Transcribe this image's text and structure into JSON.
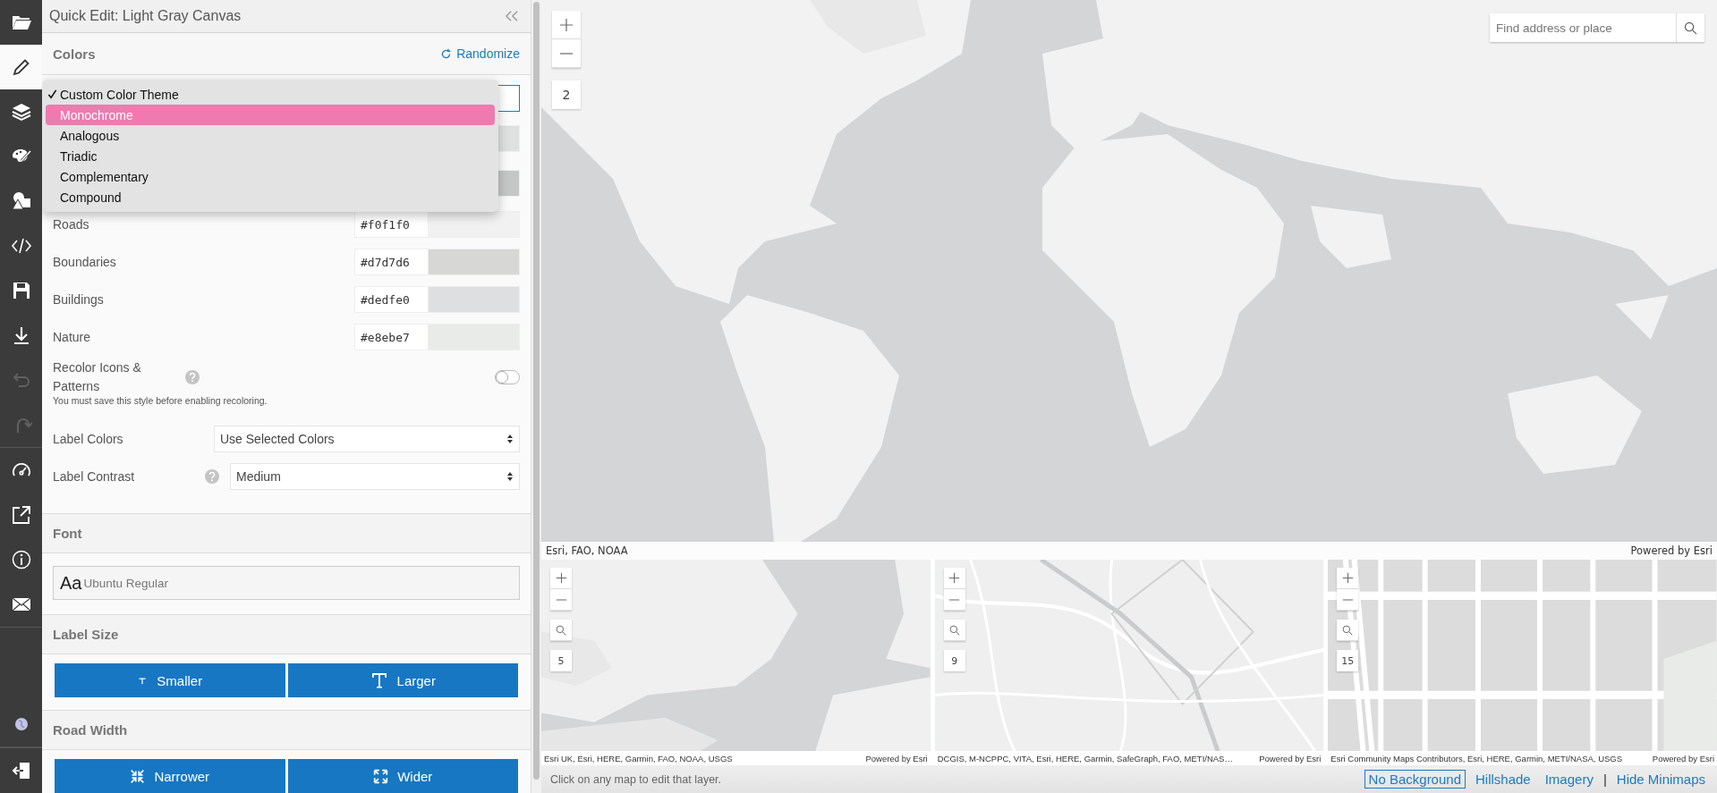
{
  "sidebar": {
    "groups": [
      {
        "items": [
          {
            "kind": "folder",
            "selected": false,
            "disabled": false
          },
          {
            "kind": "pencil",
            "selected": true,
            "disabled": false
          },
          {
            "kind": "layers",
            "selected": false,
            "disabled": false
          },
          {
            "kind": "palette",
            "selected": false,
            "disabled": false
          },
          {
            "kind": "shapes",
            "selected": false,
            "disabled": false
          },
          {
            "kind": "code",
            "selected": false,
            "disabled": false
          },
          {
            "kind": "save",
            "selected": false,
            "disabled": false
          },
          {
            "kind": "download",
            "selected": false,
            "disabled": false
          },
          {
            "kind": "undo",
            "selected": false,
            "disabled": true
          },
          {
            "kind": "redo",
            "selected": false,
            "disabled": true
          }
        ]
      },
      {
        "items": [
          {
            "kind": "gauge",
            "selected": false,
            "disabled": false
          },
          {
            "kind": "external",
            "selected": false,
            "disabled": false
          },
          {
            "kind": "info",
            "selected": false,
            "disabled": false
          },
          {
            "kind": "mail",
            "selected": false,
            "disabled": false
          }
        ]
      },
      {
        "items": [
          {
            "kind": "globe",
            "selected": false,
            "disabled": false
          }
        ]
      },
      {
        "items": [
          {
            "kind": "exit",
            "selected": false,
            "disabled": false
          }
        ]
      }
    ]
  },
  "panel": {
    "title": "Quick Edit: Light Gray Canvas",
    "colors": {
      "heading": "Colors",
      "randomize": "Randomize",
      "theme_menu": {
        "options": [
          {
            "label": "Custom Color Theme",
            "checked": true,
            "highlighted": false
          },
          {
            "label": "Monochrome",
            "checked": false,
            "highlighted": true
          },
          {
            "label": "Analogous",
            "checked": false,
            "highlighted": false
          },
          {
            "label": "Triadic",
            "checked": false,
            "highlighted": false
          },
          {
            "label": "Complementary",
            "checked": false,
            "highlighted": false
          },
          {
            "label": "Compound",
            "checked": false,
            "highlighted": false
          }
        ]
      },
      "covered_swatches": [
        {
          "color": "#dfe0e0"
        },
        {
          "color": "#c5c6c6"
        }
      ],
      "layers": [
        {
          "label": "Roads",
          "value": "#f0f1f0"
        },
        {
          "label": "Boundaries",
          "value": "#d7d7d6"
        },
        {
          "label": "Buildings",
          "value": "#dedfe0"
        },
        {
          "label": "Nature",
          "value": "#e8ebe7"
        }
      ],
      "recolor": {
        "label": "Recolor Icons & Patterns",
        "on": false,
        "note": "You must save this style before enabling recoloring."
      },
      "label_colors": {
        "label": "Label Colors",
        "value": "Use Selected Colors"
      },
      "label_contrast": {
        "label": "Label Contrast",
        "value": "Medium"
      }
    },
    "font": {
      "heading": "Font",
      "sample": "Aa",
      "value": "Ubuntu Regular"
    },
    "label_size": {
      "heading": "Label Size",
      "buttons": [
        {
          "label": "Smaller",
          "kind": "small-t"
        },
        {
          "label": "Larger",
          "kind": "large-t"
        }
      ]
    },
    "road_width": {
      "heading": "Road Width",
      "buttons": [
        {
          "label": "Narrower",
          "kind": "shrink"
        },
        {
          "label": "Wider",
          "kind": "expand"
        }
      ]
    }
  },
  "main_map": {
    "zoom_level": "2",
    "search": {
      "placeholder": "Find address or place"
    },
    "attribution": "Esri, FAO, NOAA",
    "powered_by": "Powered by Esri"
  },
  "minimaps": [
    {
      "zoom_level": "5",
      "attribution": "Esri UK, Esri, HERE, Garmin, FAO, NOAA, USGS",
      "powered_by": "Powered by Esri"
    },
    {
      "zoom_level": "9",
      "attribution": "DCGIS, M-NCPPC, VITA, Esri, HERE, Garmin, SafeGraph, FAO, METI/NAS…",
      "powered_by": "Powered by Esri"
    },
    {
      "zoom_level": "15",
      "attribution": "Esri Community Maps Contributors, Esri, HERE, Garmin, METI/NASA, USGS",
      "powered_by": "Powered by Esri"
    }
  ],
  "bottom_bar": {
    "hint": "Click on any map to edit that layer.",
    "links": [
      {
        "kind": "link",
        "label": "No Background",
        "selected": true
      },
      {
        "kind": "link",
        "label": "Hillshade",
        "selected": false
      },
      {
        "kind": "link",
        "label": "Imagery",
        "selected": false
      },
      {
        "kind": "separator",
        "label": "|"
      },
      {
        "kind": "link",
        "label": "Hide Minimaps",
        "selected": false
      }
    ]
  }
}
